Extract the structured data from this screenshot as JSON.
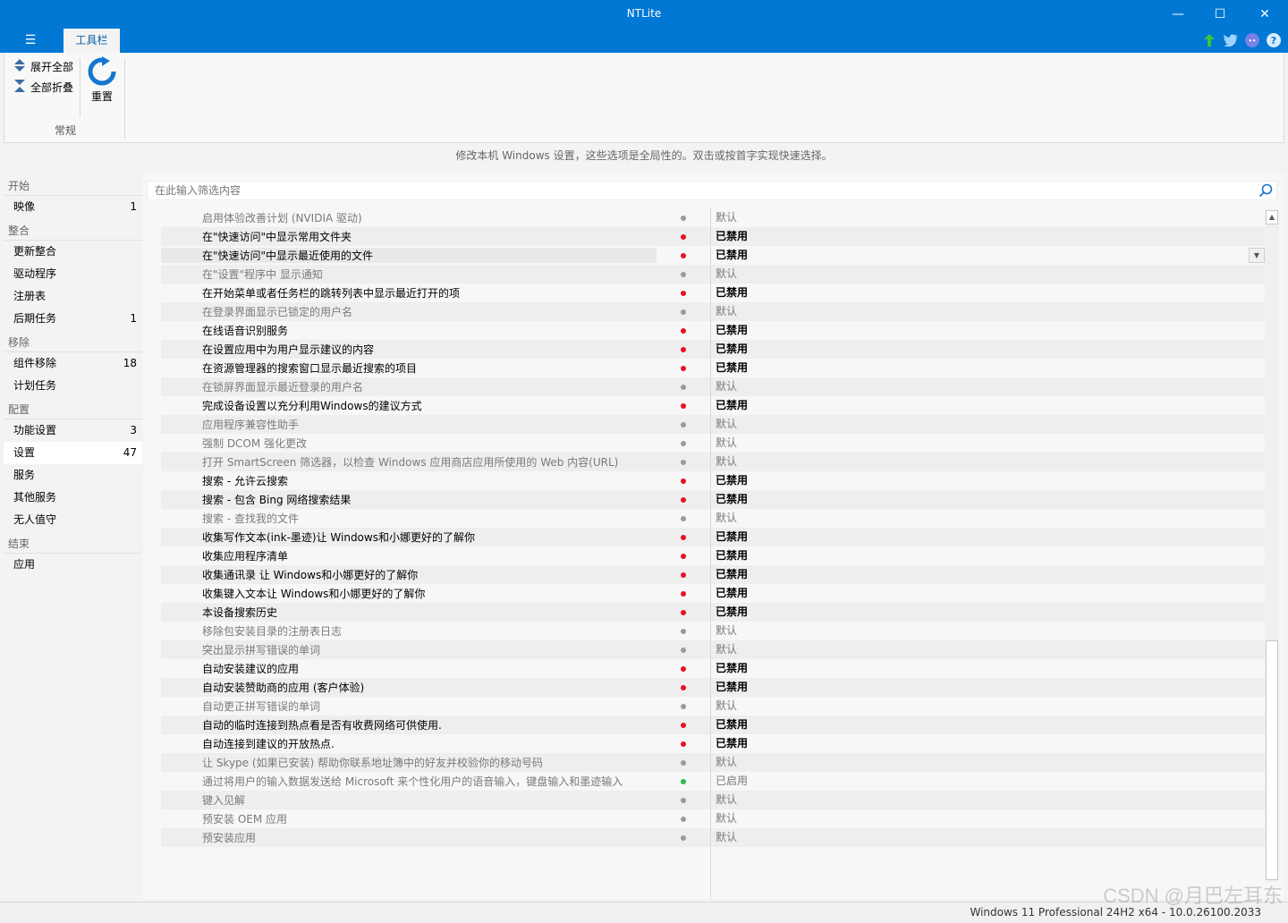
{
  "window": {
    "title": "NTLite"
  },
  "ribbon": {
    "tab_label": "工具栏",
    "expand_all": "展开全部",
    "collapse_all": "全部折叠",
    "reset": "重置",
    "group_label": "常规"
  },
  "description": "修改本机 Windows 设置，这些选项是全局性的。双击或按首字实现快速选择。",
  "sidebar": {
    "sections": [
      {
        "title": "开始",
        "items": [
          {
            "label": "映像",
            "count": "1"
          }
        ]
      },
      {
        "title": "整合",
        "items": [
          {
            "label": "更新整合",
            "count": ""
          },
          {
            "label": "驱动程序",
            "count": ""
          },
          {
            "label": "注册表",
            "count": ""
          },
          {
            "label": "后期任务",
            "count": "1"
          }
        ]
      },
      {
        "title": "移除",
        "items": [
          {
            "label": "组件移除",
            "count": "18"
          },
          {
            "label": "计划任务",
            "count": ""
          }
        ]
      },
      {
        "title": "配置",
        "items": [
          {
            "label": "功能设置",
            "count": "3"
          },
          {
            "label": "设置",
            "count": "47",
            "active": true
          },
          {
            "label": "服务",
            "count": ""
          },
          {
            "label": "其他服务",
            "count": ""
          },
          {
            "label": "无人值守",
            "count": ""
          }
        ]
      },
      {
        "title": "结束",
        "items": [
          {
            "label": "应用",
            "count": ""
          }
        ]
      }
    ]
  },
  "filter": {
    "placeholder": "在此输入筛选内容"
  },
  "status_colors": {
    "默认": "#9a9a9a",
    "已禁用": "#e81123",
    "已启用": "#2db84d"
  },
  "settings": [
    {
      "name": "启用体验改善计划 (NVIDIA 驱动)",
      "value": "默认"
    },
    {
      "name": "在\"快速访问\"中显示常用文件夹",
      "value": "已禁用"
    },
    {
      "name": "在\"快速访问\"中显示最近使用的文件",
      "value": "已禁用",
      "selected": true
    },
    {
      "name": "在\"设置\"程序中 显示通知",
      "value": "默认"
    },
    {
      "name": "在开始菜单或者任务栏的跳转列表中显示最近打开的项",
      "value": "已禁用"
    },
    {
      "name": "在登录界面显示已锁定的用户名",
      "value": "默认"
    },
    {
      "name": "在线语音识别服务",
      "value": "已禁用"
    },
    {
      "name": "在设置应用中为用户显示建议的内容",
      "value": "已禁用"
    },
    {
      "name": "在资源管理器的搜索窗口显示最近搜索的项目",
      "value": "已禁用"
    },
    {
      "name": "在锁屏界面显示最近登录的用户名",
      "value": "默认"
    },
    {
      "name": "完成设备设置以充分利用Windows的建议方式",
      "value": "已禁用"
    },
    {
      "name": "应用程序兼容性助手",
      "value": "默认"
    },
    {
      "name": "强制 DCOM 强化更改",
      "value": "默认"
    },
    {
      "name": "打开 SmartScreen 筛选器，以检查 Windows 应用商店应用所使用的 Web 内容(URL)",
      "value": "默认"
    },
    {
      "name": "搜索 - 允许云搜索",
      "value": "已禁用"
    },
    {
      "name": "搜索 - 包含 Bing 网络搜索结果",
      "value": "已禁用"
    },
    {
      "name": "搜索 - 查找我的文件",
      "value": "默认"
    },
    {
      "name": "收集写作文本(ink-墨迹)让 Windows和小娜更好的了解你",
      "value": "已禁用"
    },
    {
      "name": "收集应用程序清单",
      "value": "已禁用"
    },
    {
      "name": "收集通讯录 让 Windows和小娜更好的了解你",
      "value": "已禁用"
    },
    {
      "name": "收集键入文本让 Windows和小娜更好的了解你",
      "value": "已禁用"
    },
    {
      "name": "本设备搜索历史",
      "value": "已禁用"
    },
    {
      "name": "移除包安装目录的注册表日志",
      "value": "默认"
    },
    {
      "name": "突出显示拼写错误的单词",
      "value": "默认"
    },
    {
      "name": "自动安装建议的应用",
      "value": "已禁用"
    },
    {
      "name": "自动安装赞助商的应用 (客户体验)",
      "value": "已禁用"
    },
    {
      "name": "自动更正拼写错误的单词",
      "value": "默认"
    },
    {
      "name": "自动的临时连接到热点看是否有收费网络可供使用.",
      "value": "已禁用"
    },
    {
      "name": "自动连接到建议的开放热点.",
      "value": "已禁用"
    },
    {
      "name": "让 Skype (如果已安装) 帮助你联系地址簿中的好友并校验你的移动号码",
      "value": "默认"
    },
    {
      "name": "通过将用户的输入数据发送给 Microsoft 来个性化用户的语音输入，键盘输入和墨迹输入",
      "value": "已启用"
    },
    {
      "name": "键入见解",
      "value": "默认"
    },
    {
      "name": "预安装 OEM 应用",
      "value": "默认"
    },
    {
      "name": "预安装应用",
      "value": "默认"
    }
  ],
  "statusbar": {
    "version": "Windows 11 Professional 24H2 x64 - 10.0.26100.2033"
  },
  "watermark": "CSDN @月巴左耳东"
}
